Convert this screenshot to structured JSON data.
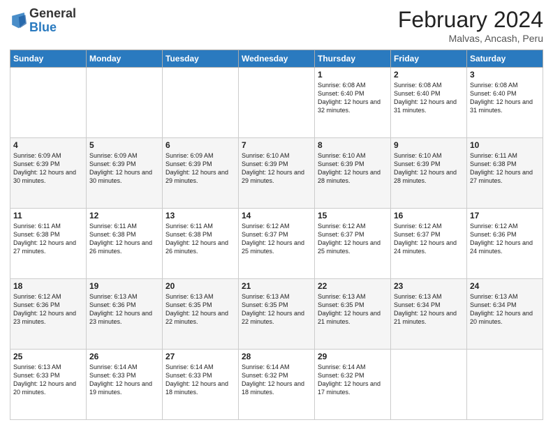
{
  "header": {
    "logo_general": "General",
    "logo_blue": "Blue",
    "title": "February 2024",
    "subtitle": "Malvas, Ancash, Peru"
  },
  "days_of_week": [
    "Sunday",
    "Monday",
    "Tuesday",
    "Wednesday",
    "Thursday",
    "Friday",
    "Saturday"
  ],
  "weeks": [
    [
      {
        "day": "",
        "info": ""
      },
      {
        "day": "",
        "info": ""
      },
      {
        "day": "",
        "info": ""
      },
      {
        "day": "",
        "info": ""
      },
      {
        "day": "1",
        "info": "Sunrise: 6:08 AM\nSunset: 6:40 PM\nDaylight: 12 hours and 32 minutes."
      },
      {
        "day": "2",
        "info": "Sunrise: 6:08 AM\nSunset: 6:40 PM\nDaylight: 12 hours and 31 minutes."
      },
      {
        "day": "3",
        "info": "Sunrise: 6:08 AM\nSunset: 6:40 PM\nDaylight: 12 hours and 31 minutes."
      }
    ],
    [
      {
        "day": "4",
        "info": "Sunrise: 6:09 AM\nSunset: 6:39 PM\nDaylight: 12 hours and 30 minutes."
      },
      {
        "day": "5",
        "info": "Sunrise: 6:09 AM\nSunset: 6:39 PM\nDaylight: 12 hours and 30 minutes."
      },
      {
        "day": "6",
        "info": "Sunrise: 6:09 AM\nSunset: 6:39 PM\nDaylight: 12 hours and 29 minutes."
      },
      {
        "day": "7",
        "info": "Sunrise: 6:10 AM\nSunset: 6:39 PM\nDaylight: 12 hours and 29 minutes."
      },
      {
        "day": "8",
        "info": "Sunrise: 6:10 AM\nSunset: 6:39 PM\nDaylight: 12 hours and 28 minutes."
      },
      {
        "day": "9",
        "info": "Sunrise: 6:10 AM\nSunset: 6:39 PM\nDaylight: 12 hours and 28 minutes."
      },
      {
        "day": "10",
        "info": "Sunrise: 6:11 AM\nSunset: 6:38 PM\nDaylight: 12 hours and 27 minutes."
      }
    ],
    [
      {
        "day": "11",
        "info": "Sunrise: 6:11 AM\nSunset: 6:38 PM\nDaylight: 12 hours and 27 minutes."
      },
      {
        "day": "12",
        "info": "Sunrise: 6:11 AM\nSunset: 6:38 PM\nDaylight: 12 hours and 26 minutes."
      },
      {
        "day": "13",
        "info": "Sunrise: 6:11 AM\nSunset: 6:38 PM\nDaylight: 12 hours and 26 minutes."
      },
      {
        "day": "14",
        "info": "Sunrise: 6:12 AM\nSunset: 6:37 PM\nDaylight: 12 hours and 25 minutes."
      },
      {
        "day": "15",
        "info": "Sunrise: 6:12 AM\nSunset: 6:37 PM\nDaylight: 12 hours and 25 minutes."
      },
      {
        "day": "16",
        "info": "Sunrise: 6:12 AM\nSunset: 6:37 PM\nDaylight: 12 hours and 24 minutes."
      },
      {
        "day": "17",
        "info": "Sunrise: 6:12 AM\nSunset: 6:36 PM\nDaylight: 12 hours and 24 minutes."
      }
    ],
    [
      {
        "day": "18",
        "info": "Sunrise: 6:12 AM\nSunset: 6:36 PM\nDaylight: 12 hours and 23 minutes."
      },
      {
        "day": "19",
        "info": "Sunrise: 6:13 AM\nSunset: 6:36 PM\nDaylight: 12 hours and 23 minutes."
      },
      {
        "day": "20",
        "info": "Sunrise: 6:13 AM\nSunset: 6:35 PM\nDaylight: 12 hours and 22 minutes."
      },
      {
        "day": "21",
        "info": "Sunrise: 6:13 AM\nSunset: 6:35 PM\nDaylight: 12 hours and 22 minutes."
      },
      {
        "day": "22",
        "info": "Sunrise: 6:13 AM\nSunset: 6:35 PM\nDaylight: 12 hours and 21 minutes."
      },
      {
        "day": "23",
        "info": "Sunrise: 6:13 AM\nSunset: 6:34 PM\nDaylight: 12 hours and 21 minutes."
      },
      {
        "day": "24",
        "info": "Sunrise: 6:13 AM\nSunset: 6:34 PM\nDaylight: 12 hours and 20 minutes."
      }
    ],
    [
      {
        "day": "25",
        "info": "Sunrise: 6:13 AM\nSunset: 6:33 PM\nDaylight: 12 hours and 20 minutes."
      },
      {
        "day": "26",
        "info": "Sunrise: 6:14 AM\nSunset: 6:33 PM\nDaylight: 12 hours and 19 minutes."
      },
      {
        "day": "27",
        "info": "Sunrise: 6:14 AM\nSunset: 6:33 PM\nDaylight: 12 hours and 18 minutes."
      },
      {
        "day": "28",
        "info": "Sunrise: 6:14 AM\nSunset: 6:32 PM\nDaylight: 12 hours and 18 minutes."
      },
      {
        "day": "29",
        "info": "Sunrise: 6:14 AM\nSunset: 6:32 PM\nDaylight: 12 hours and 17 minutes."
      },
      {
        "day": "",
        "info": ""
      },
      {
        "day": "",
        "info": ""
      }
    ]
  ]
}
